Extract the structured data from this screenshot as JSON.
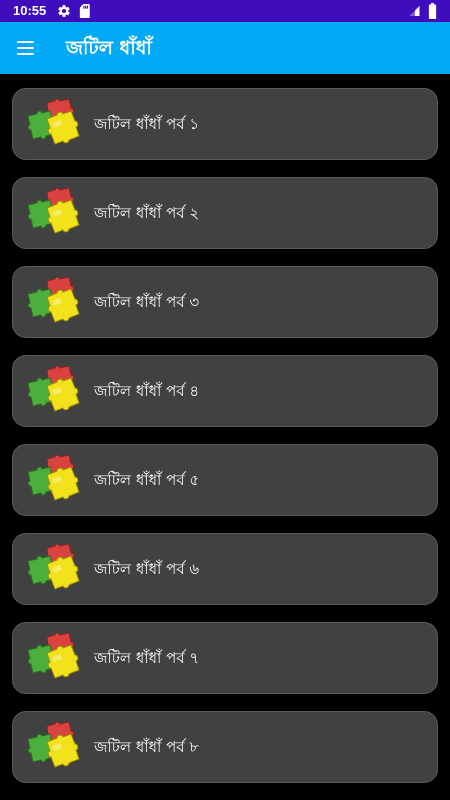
{
  "status_bar": {
    "time": "10:55",
    "icons": [
      "gear-icon",
      "sd-card-icon",
      "signal-icon",
      "battery-icon"
    ]
  },
  "app_bar": {
    "menu_icon": "hamburger-menu-icon",
    "title": "জটিল ধাঁধাঁ"
  },
  "items": [
    {
      "label": "জটিল ধাঁধাঁ পর্ব ১",
      "icon": "puzzle-pieces-icon"
    },
    {
      "label": "জটিল ধাঁধাঁ পর্ব ২",
      "icon": "puzzle-pieces-icon"
    },
    {
      "label": "জটিল ধাঁধাঁ পর্ব ৩",
      "icon": "puzzle-pieces-icon"
    },
    {
      "label": "জটিল ধাঁধাঁ পর্ব ৪",
      "icon": "puzzle-pieces-icon"
    },
    {
      "label": "জটিল ধাঁধাঁ পর্ব ৫",
      "icon": "puzzle-pieces-icon"
    },
    {
      "label": "জটিল ধাঁধাঁ পর্ব ৬",
      "icon": "puzzle-pieces-icon"
    },
    {
      "label": "জটিল ধাঁধাঁ পর্ব ৭",
      "icon": "puzzle-pieces-icon"
    },
    {
      "label": "জটিল ধাঁধাঁ পর্ব ৮",
      "icon": "puzzle-pieces-icon"
    }
  ],
  "colors": {
    "status_bar": "#3f0dbb",
    "app_bar": "#03a9f4",
    "background": "#000000",
    "card": "#414141",
    "text": "#ffffff",
    "puzzle_red": "#d9423e",
    "puzzle_green": "#4caf3c",
    "puzzle_yellow": "#f2e21b"
  }
}
